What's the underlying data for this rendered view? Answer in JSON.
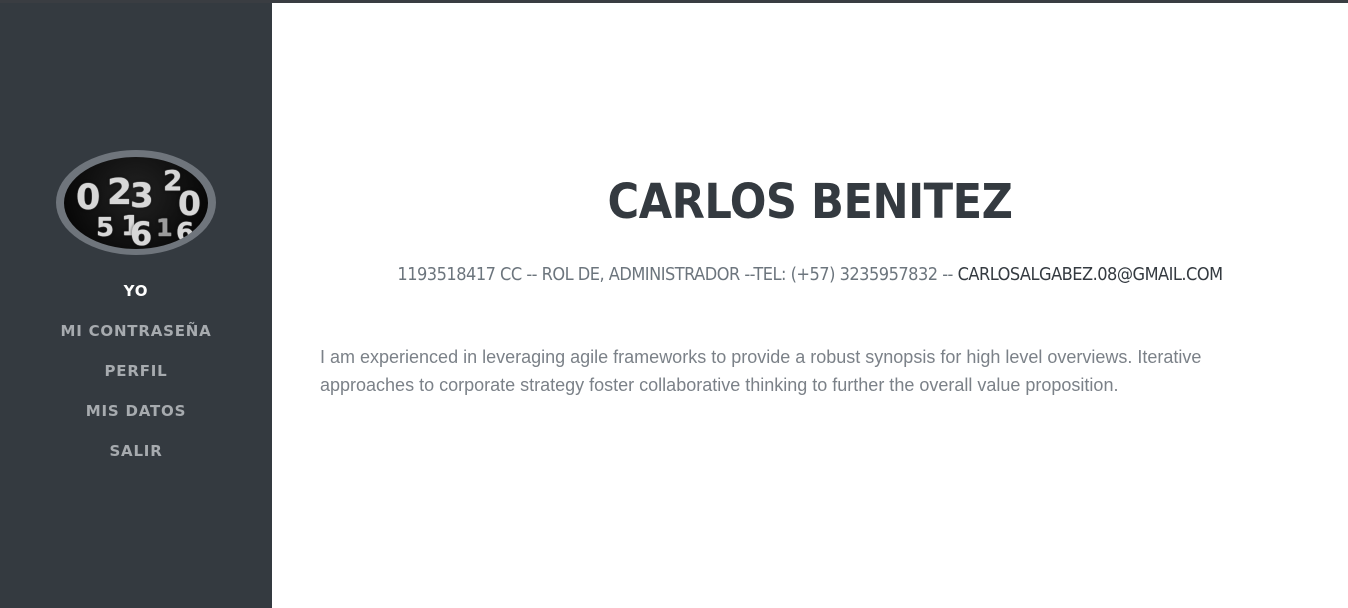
{
  "sidebar": {
    "avatar_digits": [
      "0",
      "2",
      "3",
      "2",
      "0",
      "5",
      "1",
      "6",
      "1",
      "6"
    ],
    "nav": [
      {
        "label": "YO",
        "active": true
      },
      {
        "label": "MI CONTRASEÑA",
        "active": false
      },
      {
        "label": "PERFIL",
        "active": false
      },
      {
        "label": "MIS DATOS",
        "active": false
      },
      {
        "label": "SALIR",
        "active": false
      }
    ]
  },
  "main": {
    "name": "CARLOS BENITEZ",
    "subhead": {
      "prefix": "1193518417 CC -- ROL DE, ADMINISTRADOR --TEL: (+57) 3235957832 --",
      "email": "CARLOSALGABEZ.08@GMAIL.COM"
    },
    "bio": "I am experienced in leveraging agile frameworks to provide a robust synopsis for high level overviews. Iterative approaches to corporate strategy foster collaborative thinking to further the overall value proposition."
  },
  "colors": {
    "sidebar_bg": "#343a40",
    "nav_text": "#a7abaf",
    "nav_active": "#ffffff",
    "heading": "#343a40",
    "muted_text": "#6c757d",
    "bio_text": "#7b8188"
  }
}
